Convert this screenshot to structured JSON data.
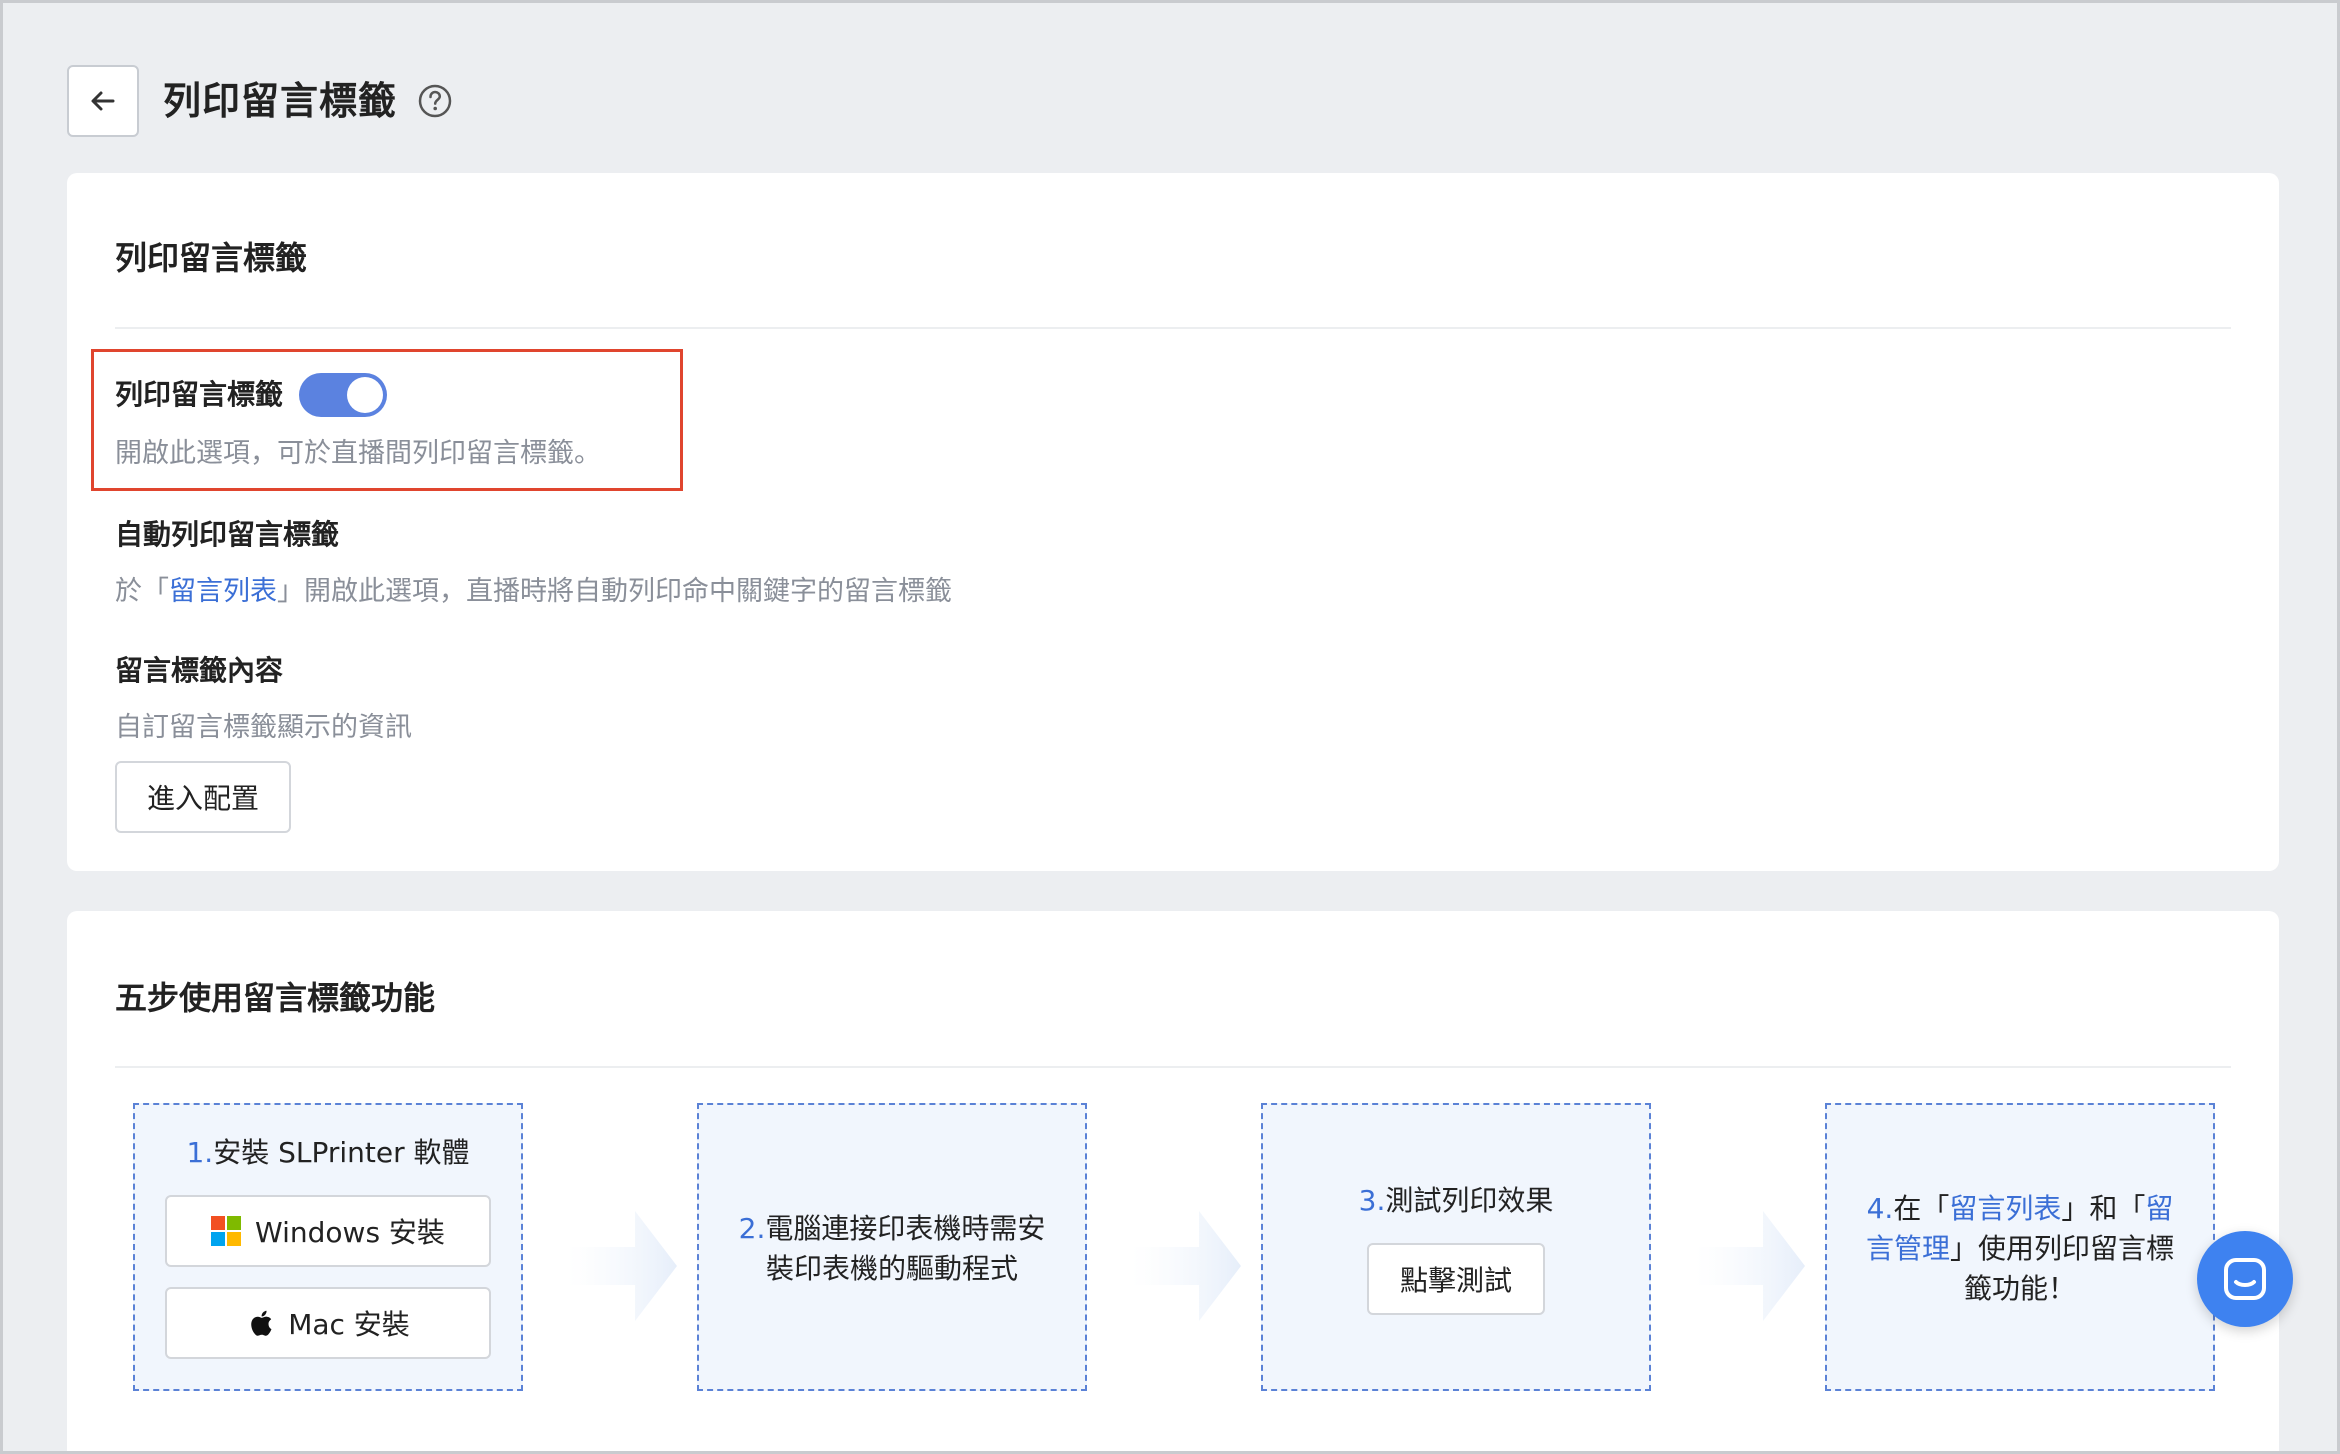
{
  "header": {
    "title": "列印留言標籤"
  },
  "settings_card": {
    "title": "列印留言標籤",
    "print_label": {
      "label": "列印留言標籤",
      "enabled": true,
      "description": "開啟此選項，可於直播間列印留言標籤。"
    },
    "auto_print": {
      "label": "自動列印留言標籤",
      "desc_prefix": "於「",
      "desc_link": "留言列表",
      "desc_suffix": "」開啟此選項，直播時將自動列印命中關鍵字的留言標籤"
    },
    "label_content": {
      "label": "留言標籤內容",
      "description": "自訂留言標籤顯示的資訊",
      "config_button": "進入配置"
    }
  },
  "steps_card": {
    "title": "五步使用留言標籤功能",
    "step1": {
      "num": "1.",
      "text": "安裝 SLPrinter 軟體",
      "windows_button": "Windows 安裝",
      "mac_button": "Mac 安裝"
    },
    "step2": {
      "num": "2.",
      "line1": "電腦連接印表機時需安",
      "line2": "裝印表機的驅動程式"
    },
    "step3": {
      "num": "3.",
      "text": "測試列印效果",
      "test_button": "點擊測試"
    },
    "step4": {
      "num": "4.",
      "p1": "在「",
      "link1": "留言列表",
      "p2": "」和「",
      "link2a": "留",
      "link2b": "言管理",
      "p3": "」使用列印留言標",
      "p4": "籤功能！"
    }
  },
  "colors": {
    "accent": "#3b6fd6",
    "toggle_on": "#5b82e0",
    "highlight": "#e0452e",
    "chat": "#3e82f0"
  }
}
